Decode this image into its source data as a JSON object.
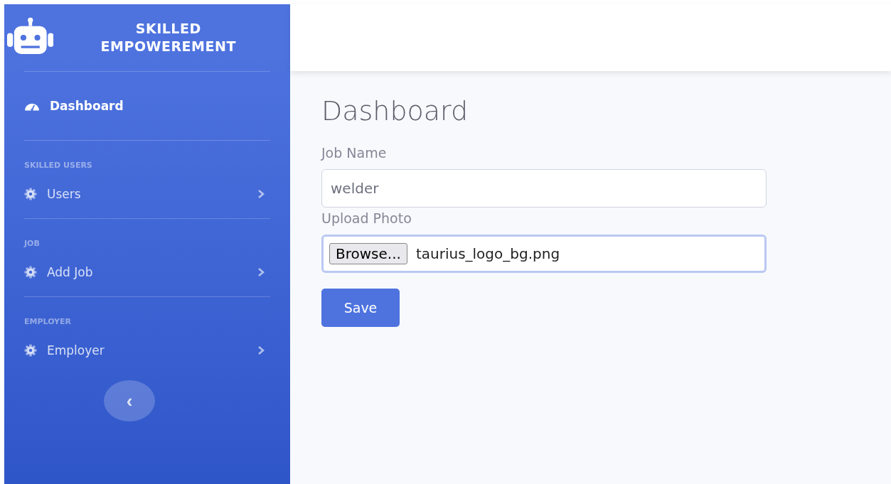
{
  "sidebar": {
    "brand": "SKILLED EMPOWEREMENT",
    "items": [
      {
        "kind": "dashboard",
        "label": "Dashboard",
        "selected": true
      },
      {
        "kind": "heading",
        "label": "SKILLED USERS"
      },
      {
        "kind": "menu",
        "label": "Users",
        "selected": false
      },
      {
        "kind": "heading",
        "label": "JOB"
      },
      {
        "kind": "menu",
        "label": "Add Job",
        "selected": false
      },
      {
        "kind": "heading",
        "label": "EMPLOYER"
      },
      {
        "kind": "menu",
        "label": "Employer",
        "selected": false
      }
    ],
    "toggle": "‹"
  },
  "page": {
    "title": "Dashboard",
    "fields": [
      {
        "kind": "text",
        "label": "Job Name",
        "value": "welder"
      },
      {
        "kind": "file",
        "label": "Upload Photo",
        "button": "Browse...",
        "value": "taurius_logo_bg.png"
      }
    ],
    "save": "Save"
  }
}
